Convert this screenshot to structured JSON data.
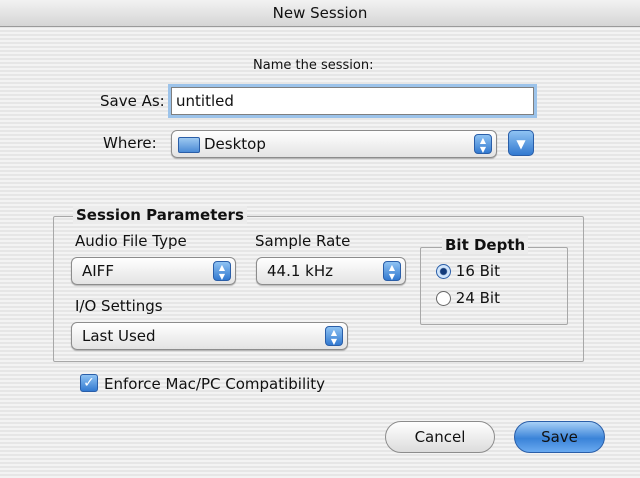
{
  "window": {
    "title": "New Session"
  },
  "name_section": {
    "heading": "Name the session:",
    "save_as_label": "Save As:",
    "save_as_value": "untitled",
    "where_label": "Where:",
    "where_value": "Desktop"
  },
  "params": {
    "title": "Session Parameters",
    "audio_file_type_label": "Audio File Type",
    "audio_file_type_value": "AIFF",
    "sample_rate_label": "Sample Rate",
    "sample_rate_value": "44.1 kHz",
    "io_settings_label": "I/O Settings",
    "io_settings_value": "Last Used",
    "bit_depth": {
      "title": "Bit Depth",
      "options": [
        {
          "label": "16 Bit",
          "selected": true
        },
        {
          "label": "24 Bit",
          "selected": false
        }
      ]
    }
  },
  "compat": {
    "label": "Enforce Mac/PC Compatibility",
    "checked": true
  },
  "buttons": {
    "cancel": "Cancel",
    "save": "Save"
  }
}
